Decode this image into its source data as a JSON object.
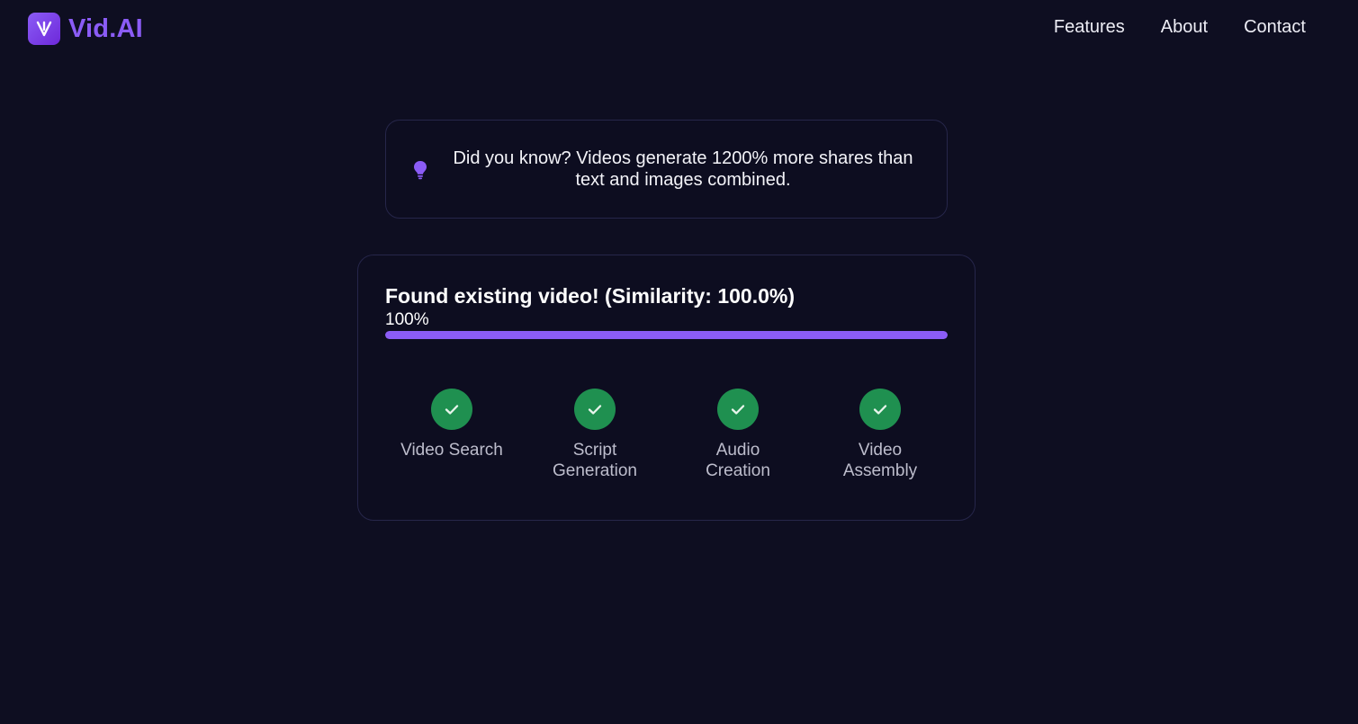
{
  "brand": {
    "name": "Vid.AI",
    "logo_icon": "v-logo-icon",
    "accent": "#8b5cf6"
  },
  "nav": {
    "items": [
      "Features",
      "About",
      "Contact"
    ]
  },
  "tip": {
    "icon": "lightbulb-icon",
    "text": "Did you know? Videos generate 1200% more shares than text and images combined."
  },
  "progress": {
    "title": "Found existing video! (Similarity: 100.0%)",
    "percent_label": "100%",
    "fraction": 1.0,
    "bar_color": "#8b5cf6",
    "steps": [
      {
        "label": "Video Search",
        "status": "complete",
        "icon": "check-icon"
      },
      {
        "label": "Script Generation",
        "status": "complete",
        "icon": "check-icon"
      },
      {
        "label": "Audio Creation",
        "status": "complete",
        "icon": "check-icon"
      },
      {
        "label": "Video Assembly",
        "status": "complete",
        "icon": "check-icon"
      }
    ],
    "complete_color": "#1f9050"
  }
}
